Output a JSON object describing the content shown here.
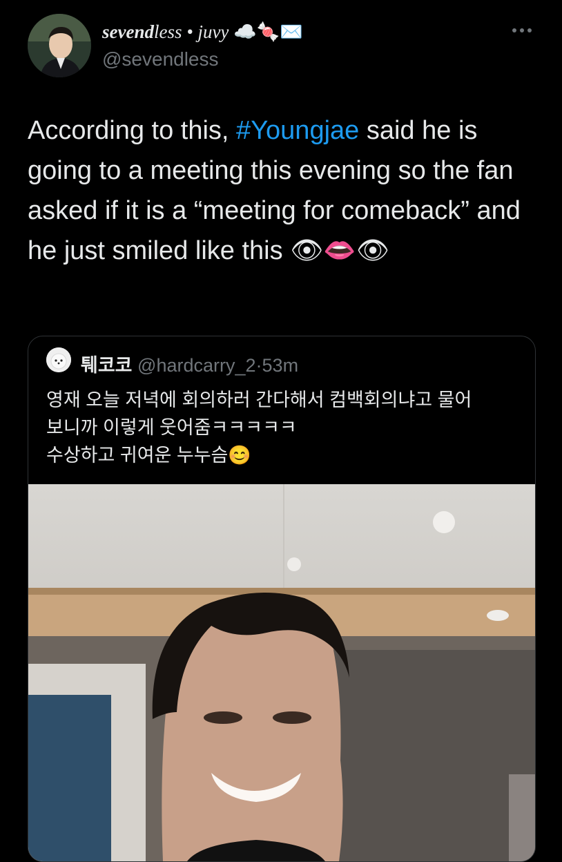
{
  "author": {
    "display_name_bold": "sevend",
    "display_name_rest": "less • juvy",
    "emoji": "☁️🍬✉️",
    "handle": "@sevendless"
  },
  "tweet": {
    "text_before": "According to this, ",
    "hashtag": "#Youngjae",
    "text_after": " said he is going to a meeting this evening so the fan asked if it is a “meeting for comeback” and he just smiled like this 👁👄👁"
  },
  "quoted_tweet": {
    "author_name": "퉤코코",
    "handle": "@hardcarry_2",
    "separator": "·",
    "time": "53m",
    "text_line1": "영재 오늘 저녁에 회의하러 간다해서 컴백회의냐고 물어",
    "text_line2": "보니까 이렇게 웃어줌ㅋㅋㅋㅋㅋ",
    "text_line3": "수상하고 귀여운 누누슴😊"
  },
  "colors": {
    "background": "#000000",
    "text": "#e7e9ea",
    "secondary": "#71767b",
    "link": "#1d9bf0"
  }
}
